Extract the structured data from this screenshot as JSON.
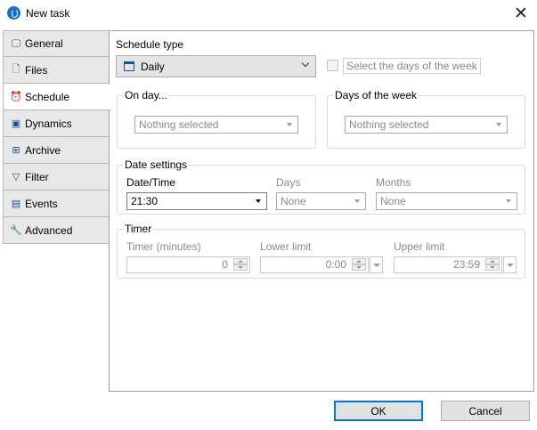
{
  "window": {
    "title": "New task"
  },
  "tabs": [
    {
      "label": "General",
      "icon": "monitor-icon",
      "active": false
    },
    {
      "label": "Files",
      "icon": "file-icon",
      "active": false
    },
    {
      "label": "Schedule",
      "icon": "clock-icon",
      "active": true
    },
    {
      "label": "Dynamics",
      "icon": "dynamics-icon",
      "active": false
    },
    {
      "label": "Archive",
      "icon": "archive-icon",
      "active": false
    },
    {
      "label": "Filter",
      "icon": "funnel-icon",
      "active": false
    },
    {
      "label": "Events",
      "icon": "calendar-icon",
      "active": false
    },
    {
      "label": "Advanced",
      "icon": "wrench-icon",
      "active": false
    }
  ],
  "schedule": {
    "type_label": "Schedule type",
    "type_value": "Daily",
    "days_of_week_checkbox": "Select the days of the week",
    "on_day": {
      "title": "On day...",
      "value": "Nothing selected"
    },
    "days_of_week": {
      "title": "Days of the week",
      "value": "Nothing selected"
    },
    "date_settings": {
      "title": "Date settings",
      "datetime_label": "Date/Time",
      "datetime_value": "21:30",
      "days_label": "Days",
      "days_value": "None",
      "months_label": "Months",
      "months_value": "None"
    },
    "timer": {
      "title": "Timer",
      "minutes_label": "Timer (minutes)",
      "minutes_value": "0",
      "lower_label": "Lower limit",
      "lower_value": "0:00",
      "upper_label": "Upper limit",
      "upper_value": "23:59"
    }
  },
  "buttons": {
    "ok": "OK",
    "cancel": "Cancel"
  },
  "colors": {
    "accent": "#0078d7",
    "icon_blue": "#1b4f9a"
  }
}
